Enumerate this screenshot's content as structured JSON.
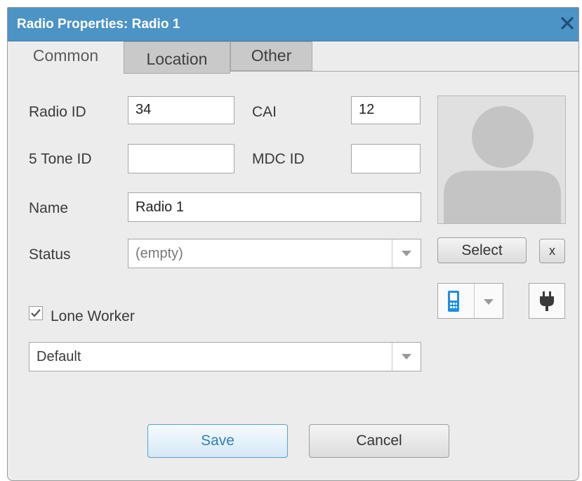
{
  "window": {
    "title": "Radio Properties: Radio 1"
  },
  "tabs": [
    {
      "label": "Common",
      "active": true
    },
    {
      "label": "Location",
      "active": false
    },
    {
      "label": "Other",
      "active": false
    }
  ],
  "form": {
    "radio_id": {
      "label": "Radio ID",
      "value": "34"
    },
    "cai": {
      "label": "CAI",
      "value": "12"
    },
    "five_tone_id": {
      "label": "5 Tone ID",
      "value": ""
    },
    "mdc_id": {
      "label": "MDC ID",
      "value": ""
    },
    "name": {
      "label": "Name",
      "value": "Radio 1"
    },
    "status": {
      "label": "Status",
      "value": "(empty)"
    },
    "lone_worker": {
      "label": "Lone Worker",
      "checked": true
    },
    "lone_worker_profile": {
      "value": "Default"
    }
  },
  "photo": {
    "select_label": "Select",
    "remove_label": "x"
  },
  "buttons": {
    "save_label": "Save",
    "cancel_label": "Cancel"
  },
  "icons": {
    "radio_device": "radio-device-icon",
    "plug": "plug-icon",
    "close": "close-icon"
  },
  "colors": {
    "titlebar": "#4c93c6",
    "device_icon": "#1c8ee6",
    "save_text": "#2f7fba"
  }
}
